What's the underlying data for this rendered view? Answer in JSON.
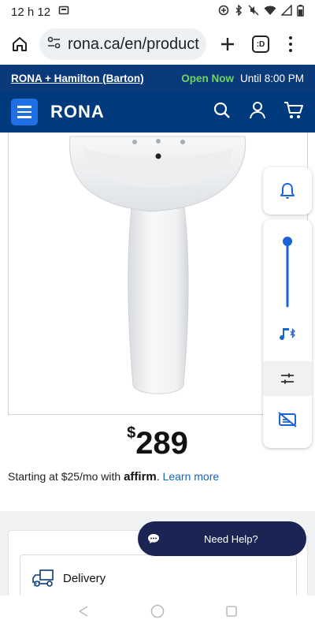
{
  "status_bar": {
    "time": "12 h 12"
  },
  "browser": {
    "url": "rona.ca/en/product",
    "tab_count_label": ":D"
  },
  "store_bar": {
    "store_name": "RONA + Hamilton (Barton)",
    "open_status": "Open Now",
    "hours": "Until 8:00 PM"
  },
  "header": {
    "logo_text": "RONA",
    "brand_color": "#003a7d",
    "menu_color": "#1f6fe5"
  },
  "product": {
    "price_currency": "$",
    "price_value": "289",
    "financing_prefix": "Starting at $25/mo with",
    "affirm_logo": "affirm",
    "financing_link": "Learn more"
  },
  "delivery": {
    "label": "Delivery"
  },
  "chat": {
    "label": "Need Help?"
  },
  "volume_panel": {
    "level": 0.83,
    "accent_color": "#1a63d8"
  }
}
